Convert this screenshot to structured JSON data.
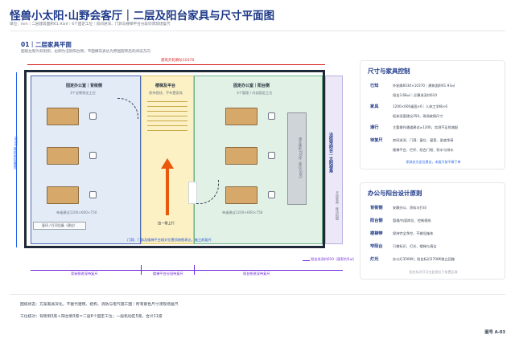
{
  "header": {
    "title": "怪兽小太阳·山野会客厅｜二层及阳台家具与尺寸平面图",
    "subtitle": "单位：mm｜二层建筑面积61.93㎡｜6个固定工位｜房间进深、门洞与楼梯平台分段均须现场复尺"
  },
  "section": {
    "heading": "01｜二层家具平面",
    "description": "图纸左侧为背街侧，右侧为沿街阳台侧；平面横向表达为原图旋转后的阅读方向"
  },
  "plan": {
    "overall_width_label": "建筑外轮廓长10370",
    "left_dim_label": "6030 建筑外轮廓宽",
    "zones": {
      "left_title": "固定办公室｜背街侧",
      "left_sub": "3个全朝侧支工位",
      "mid_title": "楼梯及平台",
      "mid_sub": "保持视线、不布置家具",
      "right_title": "固定办公室｜阳台侧",
      "right_sub": "3个管理 / 内部固定工位"
    },
    "desk_note_left": "单桌建议1200×600×750",
    "desk_note_right": "单桌建议1200×600×750",
    "corridor_note": "复印 / 打印设备（建议）",
    "stair_direction": "由一楼上行",
    "cabinet_label": "通长矮柜350深（建议1800）",
    "access_note": "门洞、门扇及楼梯平台相对位置须按图表达，施工前复尺",
    "balcony_label": "沿街窄阳台｜太阳视角",
    "balcony_sub": "不放家具 · 移动拍摄",
    "balcony_depth_label": "阳台进深约610（面积约5㎡）",
    "bottom_dims": {
      "left": "背街侧进深待复尺",
      "mid": "楼梯平台分段待复尺",
      "right": "阳台侧进深待复尺"
    }
  },
  "spec_card": {
    "title": "尺寸与家具控制",
    "rows": [
      {
        "key": "已知",
        "value": "外轮廓6030×10370｜建筑面积61.93㎡"
      },
      {
        "key": "",
        "value": "阳台3.68㎡｜反算进深约610"
      },
      {
        "key": "家具",
        "value": "1200×600桌面×6｜人体工学椅×6"
      },
      {
        "key": "",
        "value": "柜体深度建议350，现场按照尺寸"
      },
      {
        "key": "通行",
        "value": "主要操作通道建议≥1200，实测不足则减配"
      },
      {
        "key": "待复尺",
        "value": "房间进深、门洞、窗位、窗宽、梁底净高"
      },
      {
        "key": "",
        "value": "楼梯平台、栏杆、阳台门框、防水与排水"
      }
    ],
    "note": "家具仅为定位建议，未复尺前不做下单"
  },
  "principles_card": {
    "title": "办公与阳台设计原则",
    "rows": [
      {
        "key": "背街侧",
        "value": "安静办公、资料与打印"
      },
      {
        "key": "阳台侧",
        "value": "管理/内容岗位、控制视线"
      },
      {
        "key": "楼梯带",
        "value": "保持完全净空，不做设施体"
      },
      {
        "key": "窄阳台",
        "value": "只做标识、灯光、楼梯与清洁"
      },
      {
        "key": "灯光",
        "value": "办公灯3500K；阳台标识2700K独立回路"
      }
    ],
    "note": "阳台标识灯可在此规位于前置区域"
  },
  "footer": {
    "line1": "图纸状态：方案家具深化，不替代建筑、结构、消防与电气施工图｜所有紫色尺寸须现场复尺",
    "line2": "工位核对：背街侧3席＋阳台侧3席＝二层6个固定工位；一层机动区5席，合计11席"
  },
  "page_number": "图号 A-03",
  "colors": {
    "primary": "#1e3a8a",
    "dimension_red": "#dc2626",
    "dimension_purple": "#6d28d9",
    "stair_arrow": "#ea580c",
    "desk": "#d6a96b"
  }
}
